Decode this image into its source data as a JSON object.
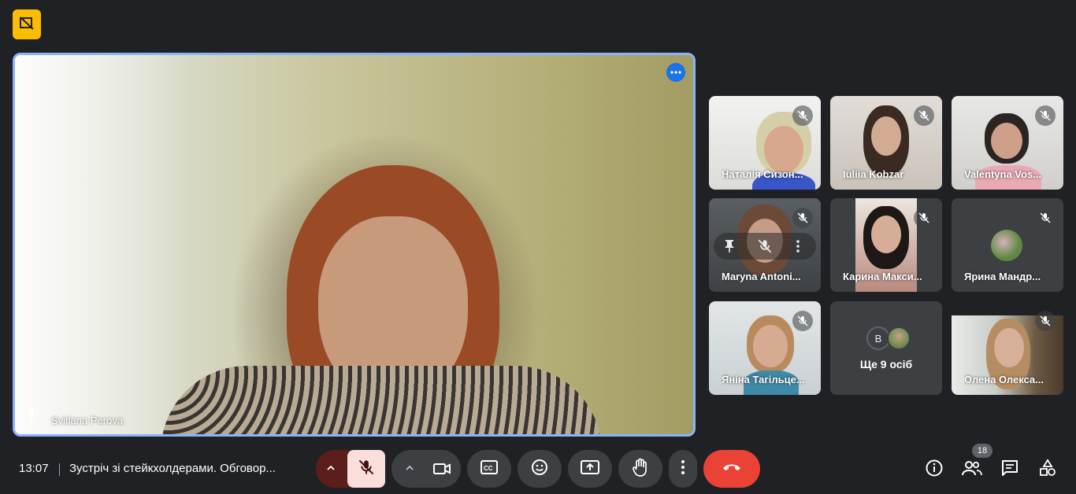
{
  "main_speaker": {
    "name": "Svitlana Perova"
  },
  "participants": [
    {
      "name": "Наталія Сизон...",
      "muted": true
    },
    {
      "name": "Iuliia Kobzar",
      "muted": true
    },
    {
      "name": "Valentyna Vos...",
      "muted": true
    },
    {
      "name": "Maryna Antoni...",
      "muted": true
    },
    {
      "name": "Карина Макси...",
      "muted": true
    },
    {
      "name": "Ярина Мандр...",
      "muted": true
    },
    {
      "name": "Яніна Тагільце...",
      "muted": true
    },
    {
      "name": "Олена Олекса...",
      "muted": true
    }
  ],
  "more_people": {
    "avatar_initial": "B",
    "label": "Ще 9 осіб"
  },
  "bottom_bar": {
    "time": "13:07",
    "meeting_title": "Зустріч зі стейкхолдерами. Обговор...",
    "participant_count": "18"
  },
  "colors": {
    "background": "#202124",
    "tile": "#3c4043",
    "active_border": "#8ab4f8",
    "leave": "#ea4335",
    "mic_off": "#f9dedc",
    "badge": "#fbbc04"
  },
  "icons": [
    "no-video-badge-icon",
    "more-options-icon",
    "pin-icon",
    "mic-off-icon",
    "chevron-up-icon",
    "camera-icon",
    "captions-icon",
    "emoji-icon",
    "present-icon",
    "raise-hand-icon",
    "more-vert-icon",
    "end-call-icon",
    "info-icon",
    "people-icon",
    "chat-icon",
    "activities-icon"
  ]
}
